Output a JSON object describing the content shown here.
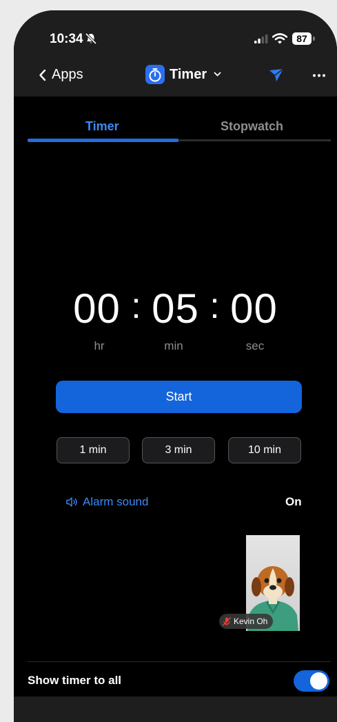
{
  "status_bar": {
    "time": "10:34",
    "battery": "87"
  },
  "nav": {
    "back_label": "Apps",
    "title": "Timer"
  },
  "tabs": [
    {
      "label": "Timer",
      "active": true
    },
    {
      "label": "Stopwatch",
      "active": false
    }
  ],
  "timer": {
    "hours": "00",
    "minutes": "05",
    "seconds": "00",
    "separator": ":",
    "unit_hr": "hr",
    "unit_min": "min",
    "unit_sec": "sec"
  },
  "start_label": "Start",
  "presets": [
    "1 min",
    "3 min",
    "10 min"
  ],
  "alarm": {
    "label": "Alarm sound",
    "state": "On"
  },
  "participant": {
    "name": "Kevin Oh",
    "muted": true
  },
  "show_timer": {
    "label": "Show timer to all",
    "enabled": true
  },
  "colors": {
    "accent": "#1464db",
    "tab_active": "#3b8af7",
    "bar": "#1e1e1e"
  },
  "icons": [
    "bell-slash-icon",
    "signal-icon",
    "wifi-icon",
    "chevron-left-icon",
    "stopwatch-icon",
    "chevron-down-icon",
    "send-icon",
    "more-icon",
    "speaker-icon",
    "mic-muted-icon"
  ]
}
